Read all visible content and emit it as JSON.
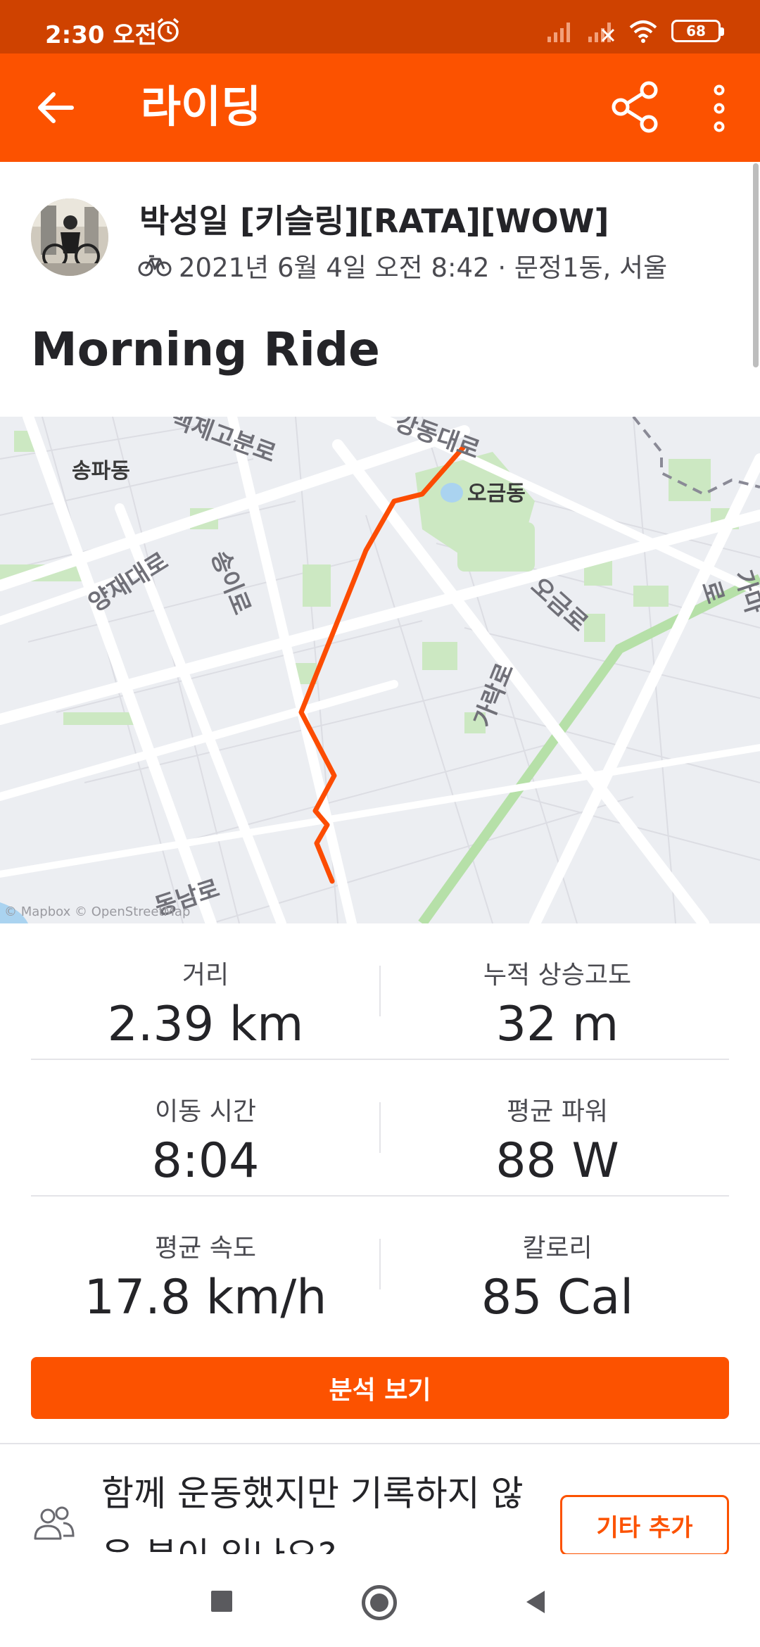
{
  "status_bar": {
    "time": "2:30 오전",
    "battery": "68",
    "icons": [
      "alarm-icon",
      "signal-icon",
      "signal-off-icon",
      "wifi-icon",
      "battery-icon"
    ]
  },
  "app_bar": {
    "title": "라이딩",
    "icons": [
      "back-arrow-icon",
      "share-icon",
      "more-vert-icon"
    ]
  },
  "activity": {
    "athlete_name": "박성일 [키슬링][RATA][WOW]",
    "meta": "2021년 6월 4일 오전 8:42 · 문정1동, 서울",
    "title": "Morning Ride"
  },
  "map": {
    "labels": {
      "songpa_dong": "송파동",
      "ogeum_dong": "오금동",
      "yangjae_daero": "양재대로",
      "songi_ro": "송이로",
      "ogeum_ro": "오금로",
      "garak_ro": "가락로",
      "dongnam_ro": "동남로",
      "gamar_ro": "가마로",
      "top_road": "백제고분로",
      "top_road2": "강동대로"
    },
    "attribution": "© Mapbox © OpenStreetMap",
    "route_color": "#fc4c02"
  },
  "stats": {
    "distance_label": "거리",
    "distance_value": "2.39 km",
    "elevation_label": "누적 상승고도",
    "elevation_value": "32 m",
    "moving_time_label": "이동 시간",
    "moving_time_value": "8:04",
    "avg_power_label": "평균 파워",
    "avg_power_value": "88 W",
    "avg_speed_label": "평균 속도",
    "avg_speed_value": "17.8 km/h",
    "calories_label": "칼로리",
    "calories_value": "85 Cal"
  },
  "actions": {
    "analyze_label": "분석 보기",
    "invite_text": "함께 운동했지만 기록하지 않은 분이 있나요?",
    "add_other_label": "기타 추가"
  },
  "colors": {
    "brand": "#fc5200",
    "status_bar": "#cf4200"
  }
}
